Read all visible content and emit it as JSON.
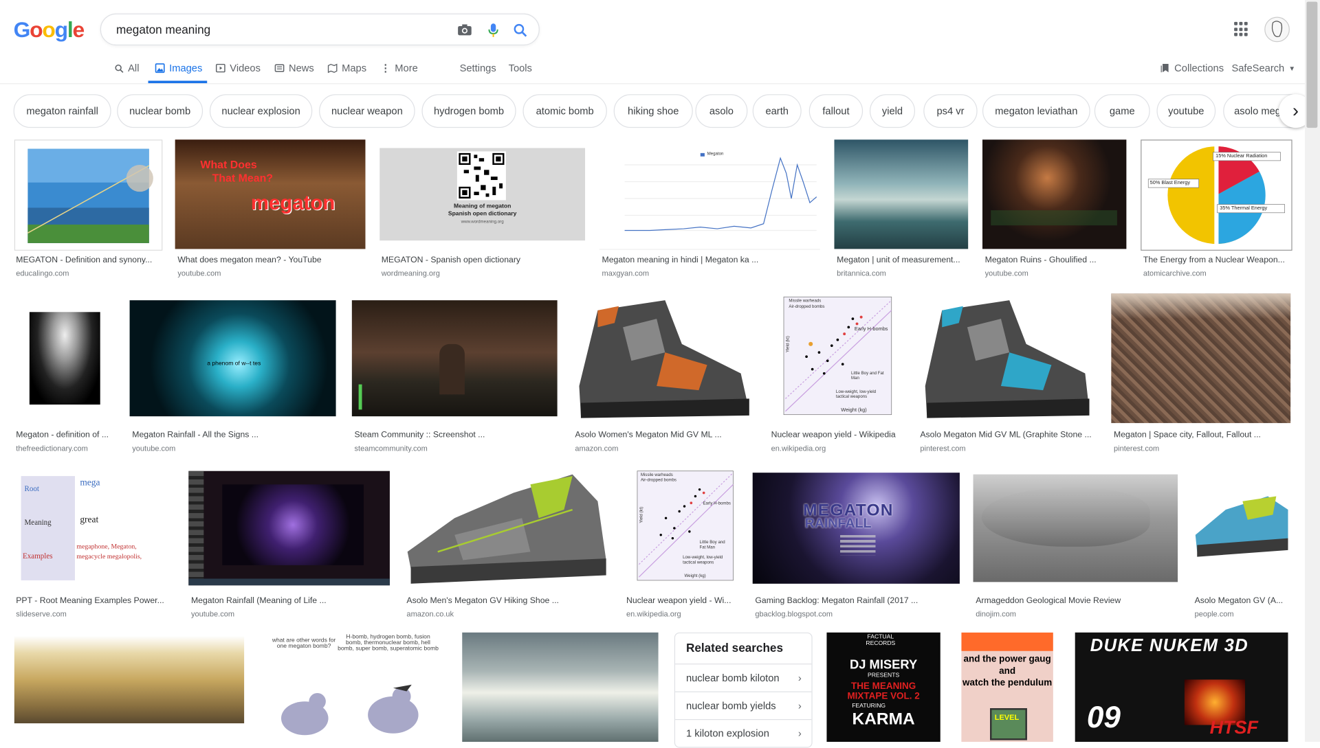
{
  "logo": "Google",
  "search": {
    "query": "megaton meaning"
  },
  "nav": {
    "all": "All",
    "images": "Images",
    "videos": "Videos",
    "news": "News",
    "maps": "Maps",
    "more": "More",
    "settings": "Settings",
    "tools": "Tools",
    "collections": "Collections",
    "safesearch": "SafeSearch"
  },
  "chips": [
    "megaton rainfall",
    "nuclear bomb",
    "nuclear explosion",
    "nuclear weapon",
    "hydrogen bomb",
    "atomic bomb",
    "hiking shoe",
    "asolo",
    "earth",
    "fallout",
    "yield",
    "ps4 vr",
    "megaton leviathan",
    "game",
    "youtube",
    "asolo meg"
  ],
  "results": [
    {
      "title": "MEGATON - Definition and synony...",
      "source": "educalingo.com"
    },
    {
      "title": "What does megaton mean? - YouTube",
      "source": "youtube.com"
    },
    {
      "title": "MEGATON - Spanish open dictionary",
      "source": "wordmeaning.org"
    },
    {
      "title": "Megaton meaning in hindi | Megaton ka ...",
      "source": "maxgyan.com"
    },
    {
      "title": "Megaton | unit of measurement...",
      "source": "britannica.com"
    },
    {
      "title": "Megaton Ruins - Ghoulified ...",
      "source": "youtube.com"
    },
    {
      "title": "The Energy from a Nuclear Weapon...",
      "source": "atomicarchive.com"
    },
    {
      "title": "Megaton - definition of ...",
      "source": "thefreedictionary.com"
    },
    {
      "title": "Megaton Rainfall - All the Signs ...",
      "source": "youtube.com"
    },
    {
      "title": "Steam Community :: Screenshot ...",
      "source": "steamcommunity.com"
    },
    {
      "title": "Asolo Women's Megaton Mid GV ML ...",
      "source": "amazon.com"
    },
    {
      "title": "Nuclear weapon yield - Wikipedia",
      "source": "en.wikipedia.org"
    },
    {
      "title": "Asolo Megaton Mid GV ML (Graphite Stone ...",
      "source": "pinterest.com"
    },
    {
      "title": "Megaton | Space city, Fallout, Fallout ...",
      "source": "pinterest.com"
    },
    {
      "title": "PPT - Root Meaning Examples Power...",
      "source": "slideserve.com"
    },
    {
      "title": "Megaton Rainfall (Meaning of Life ...",
      "source": "youtube.com"
    },
    {
      "title": "Asolo Men's Megaton GV Hiking Shoe ...",
      "source": "amazon.co.uk"
    },
    {
      "title": "Nuclear weapon yield - Wi...",
      "source": "en.wikipedia.org"
    },
    {
      "title": "Gaming Backlog: Megaton Rainfall (2017 ...",
      "source": "gbacklog.blogspot.com"
    },
    {
      "title": "Armageddon Geological Movie Review",
      "source": "dinojim.com"
    },
    {
      "title": "Asolo Megaton GV (A...",
      "source": "people.com"
    }
  ],
  "thumb_text": {
    "t2_line1": "What Does",
    "t2_line2": "That Mean?",
    "t2_big": "megaton",
    "t3_line1": "Meaning of megaton",
    "t3_line2": "Spanish open dictionary",
    "t3_line3": "www.wordmeaning.org",
    "t4_legend": "Megaton",
    "t7_a": "15% Nuclear Radiation",
    "t7_b": "50% Blast Energy",
    "t7_c": "35% Thermal Energy",
    "t9_text": "a phenom of w--t tes",
    "t11_a": "Early H-bombs",
    "t11_b": "Little Boy and Fat Man",
    "t11_c": "Low-weight, low-yield tactical weapons",
    "t11_x": "Weight (kg)",
    "t11_y": "Yield (kt)",
    "t11_l1": "Missile warheads",
    "t11_l2": "Air-dropped bombs",
    "t15_root": "Root",
    "t15_mega": "mega",
    "t15_meaning": "Meaning",
    "t15_great": "great",
    "t15_examples": "Examples",
    "t15_ex": "megaphone, Megaton, megacycle megalopolis,",
    "t19_line1": "MEGATON",
    "t19_line2": "RAINFALL",
    "b2_left": "what are other words for one megaton bomb?",
    "b2_right": "H-bomb, hydrogen bomb, fusion bomb, thermonuclear bomb, hell bomb, super bomb, superatomic bomb",
    "b4_line1": "FACTUAL RECORDS",
    "b4_line2": "DJ MISERY",
    "b4_line3": "PRESENTS",
    "b4_line4": "THE MEANING MIXTAPE VOL. 2",
    "b4_line5": "FEATURING",
    "b4_line6": "KARMA",
    "b5_line1": "and the power gaug",
    "b5_line2": "and",
    "b5_line3": "watch the pendulum",
    "b5_line4": "LEVEL",
    "b6_line1": "DUKE NUKEM 3D",
    "b6_line2": "09",
    "b6_line3": "HTSF"
  },
  "related": {
    "title": "Related searches",
    "items": [
      "nuclear bomb kiloton",
      "nuclear bomb yields",
      "1 kiloton explosion"
    ]
  }
}
